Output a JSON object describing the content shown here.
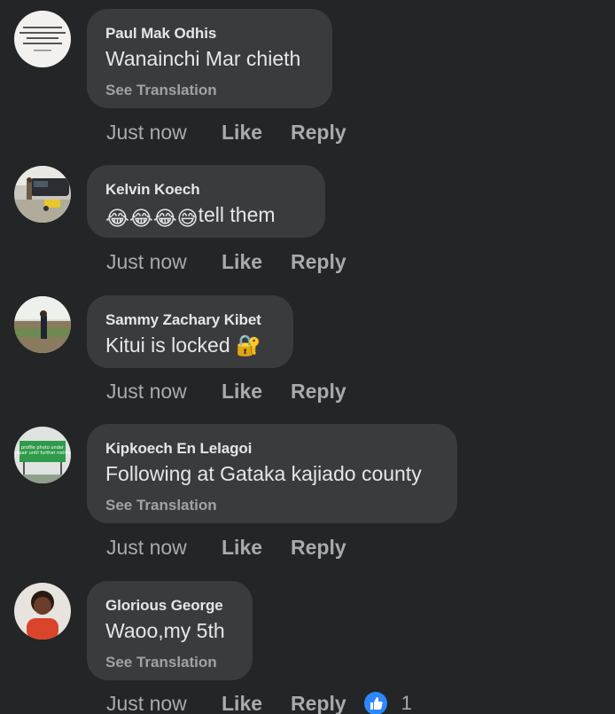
{
  "comments": [
    {
      "author": "Paul Mak Odhis",
      "text": "Wanainchi Mar chieth",
      "see_translation": "See Translation",
      "time": "Just now",
      "like": "Like",
      "reply": "Reply"
    },
    {
      "author": "Kelvin Koech",
      "emoji": [
        "😂",
        "😂",
        "😂",
        "😅"
      ],
      "text": "tell them",
      "time": "Just now",
      "like": "Like",
      "reply": "Reply"
    },
    {
      "author": "Sammy Zachary Kibet",
      "text": "Kitui is locked 🔐",
      "time": "Just now",
      "like": "Like",
      "reply": "Reply"
    },
    {
      "author": "Kipkoech En Lelagoi",
      "text": "Following at Gataka kajiado county",
      "see_translation": "See Translation",
      "avatar_sign_text": "profile photo under repair until further notice",
      "time": "Just now",
      "like": "Like",
      "reply": "Reply"
    },
    {
      "author": "Glorious George",
      "text": "Waoo,my 5th",
      "see_translation": "See Translation",
      "time": "Just now",
      "like": "Like",
      "reply": "Reply",
      "reaction_icon": "like-reaction-icon",
      "reaction_count": "1"
    }
  ],
  "colors": {
    "background": "#242526",
    "bubble": "#3a3b3c",
    "primary_text": "#e4e6eb",
    "secondary_text": "#a8aaae",
    "like_blue": "#2d88ff"
  }
}
